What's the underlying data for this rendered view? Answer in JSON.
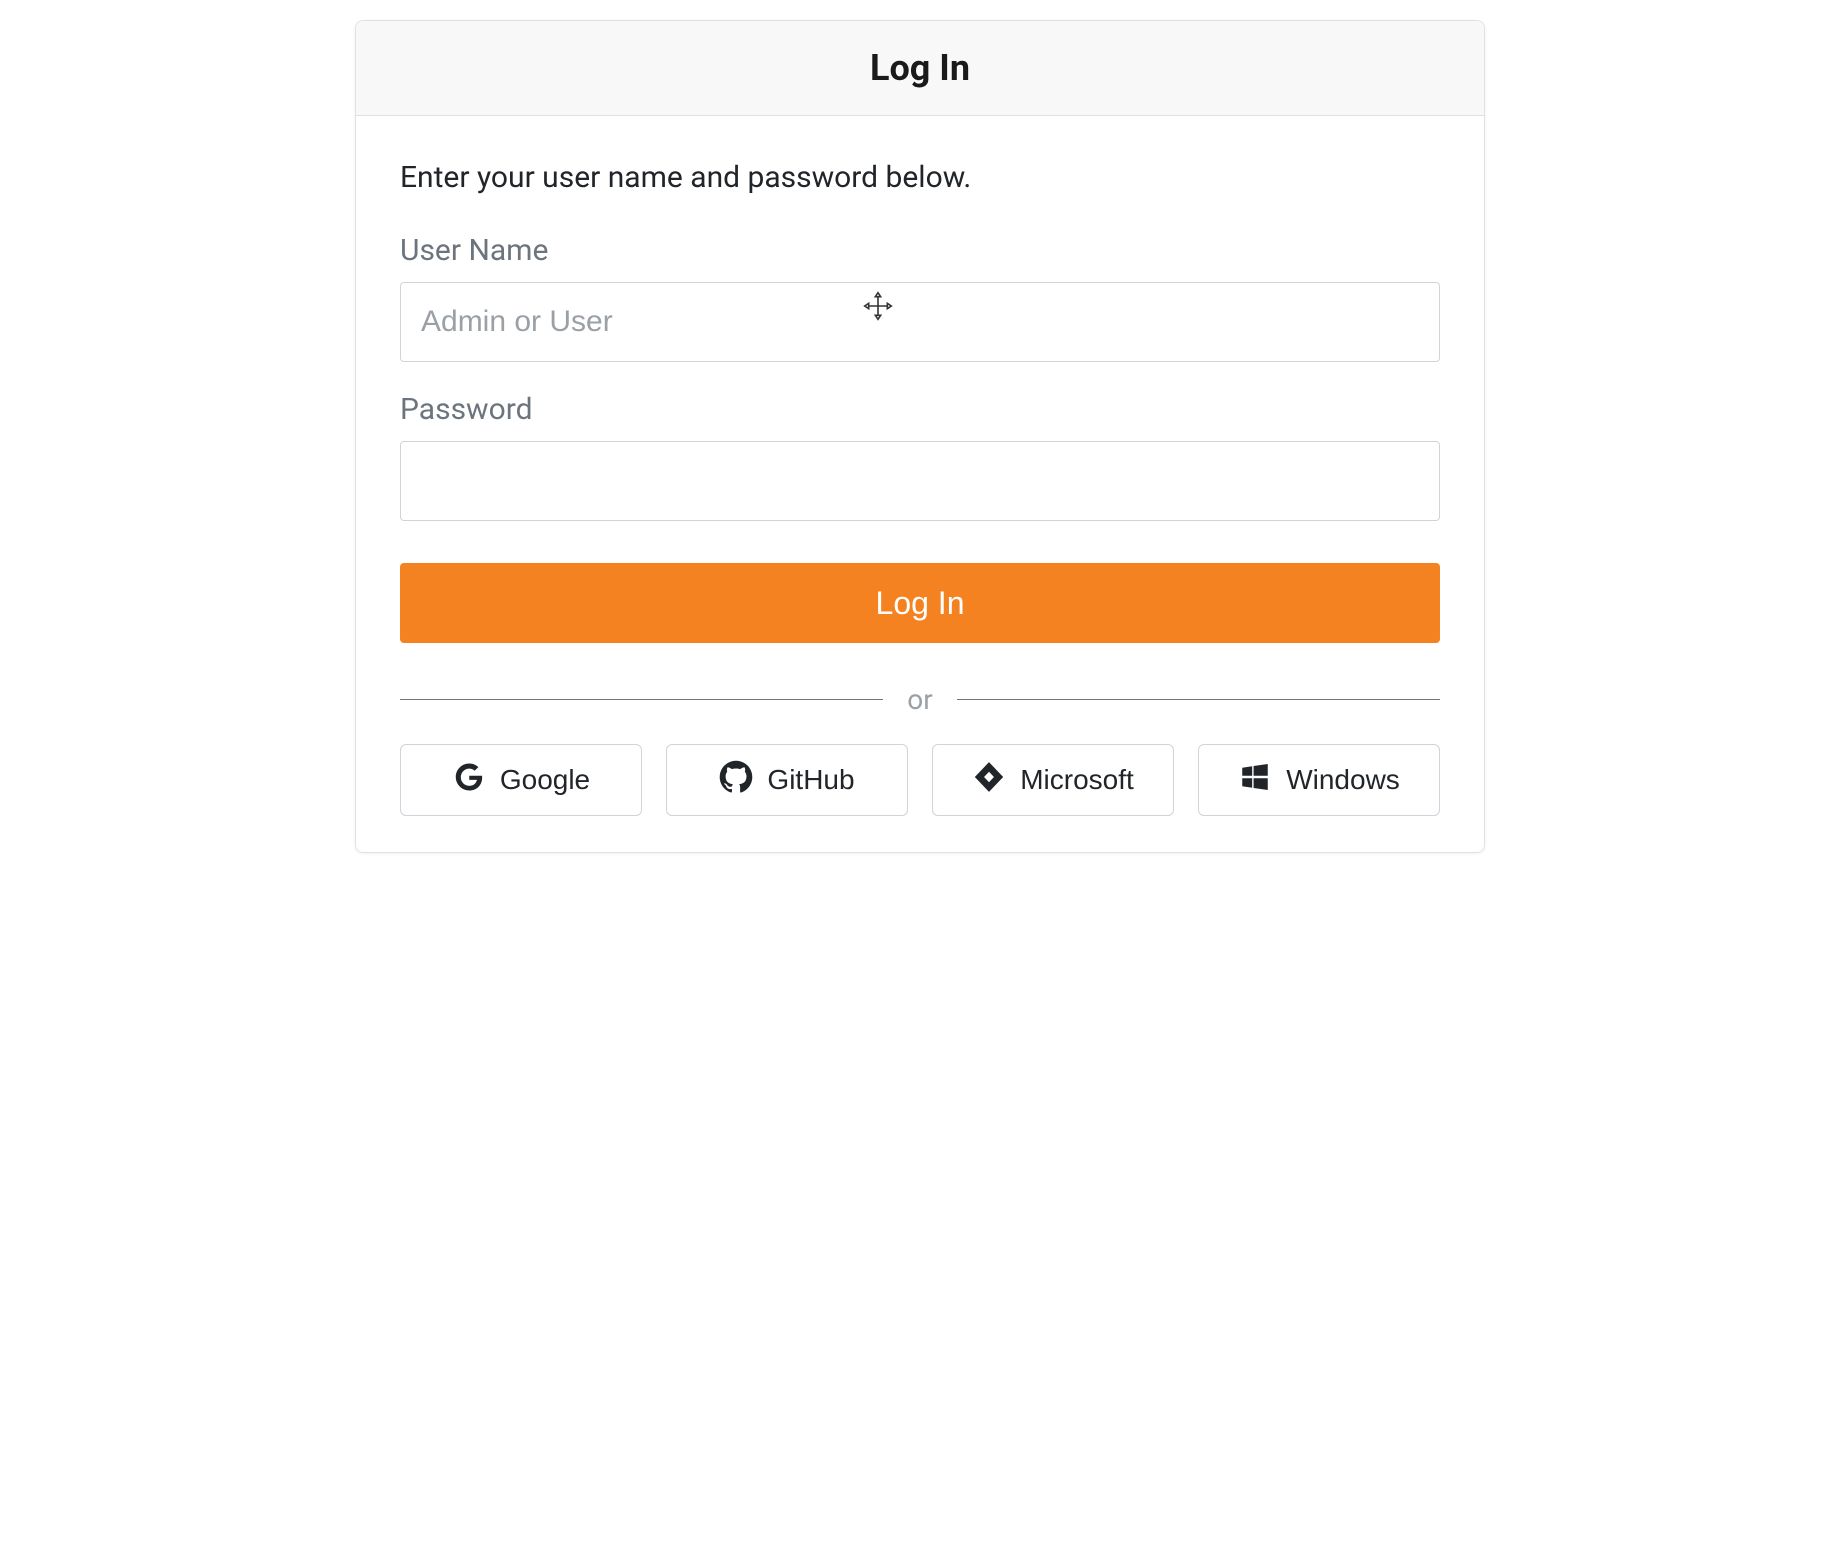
{
  "header": {
    "title": "Log In"
  },
  "instruction": "Enter your user name and password below.",
  "form": {
    "username_label": "User Name",
    "username_placeholder": "Admin or User",
    "username_value": "",
    "password_label": "Password",
    "password_value": "",
    "submit_label": "Log In"
  },
  "divider": {
    "text": "or"
  },
  "providers": [
    {
      "id": "google",
      "label": "Google"
    },
    {
      "id": "github",
      "label": "GitHub"
    },
    {
      "id": "microsoft",
      "label": "Microsoft"
    },
    {
      "id": "windows",
      "label": "Windows"
    }
  ],
  "colors": {
    "accent": "#f58220",
    "border": "#ced4da",
    "muted": "#6c757d"
  }
}
